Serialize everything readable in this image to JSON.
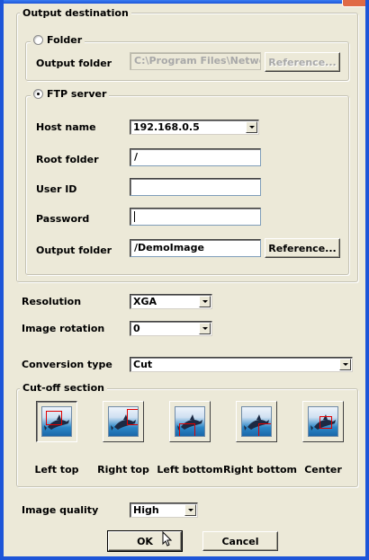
{
  "output_destination": {
    "group_label": "Output destination",
    "folder": {
      "label": "Folder",
      "output_folder_label": "Output folder",
      "output_folder_value": "C:\\Program Files\\Network",
      "reference_label": "Reference..."
    },
    "ftp": {
      "label": "FTP server",
      "host_name_label": "Host name",
      "host_name_value": "192.168.0.5",
      "root_folder_label": "Root folder",
      "root_folder_value": "/",
      "user_id_label": "User ID",
      "user_id_value": "",
      "password_label": "Password",
      "password_value": "",
      "output_folder_label": "Output folder",
      "output_folder_value": "/DemoImage",
      "reference_label": "Reference..."
    }
  },
  "resolution": {
    "label": "Resolution",
    "value": "XGA"
  },
  "image_rotation": {
    "label": "Image rotation",
    "value": "0"
  },
  "conversion_type": {
    "label": "Conversion type",
    "value": "Cut"
  },
  "cutoff": {
    "group_label": "Cut-off section",
    "options": [
      "Left top",
      "Right top",
      "Left bottom",
      "Right bottom",
      "Center"
    ],
    "selected": "Left top"
  },
  "image_quality": {
    "label": "Image quality",
    "value": "High"
  },
  "buttons": {
    "ok": "OK",
    "cancel": "Cancel"
  },
  "colors": {
    "window_frame": "#1d55d8",
    "dialog_bg": "#ece9d8",
    "cut_box": "#e00000"
  }
}
